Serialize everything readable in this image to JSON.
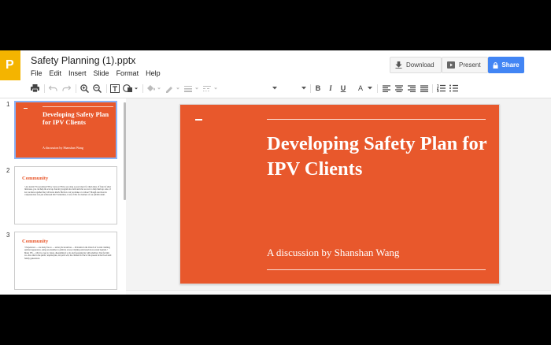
{
  "app": {
    "title": "Safety Planning (1).pptx",
    "logo_letter": "P"
  },
  "menu": [
    "File",
    "Edit",
    "Insert",
    "Slide",
    "Format",
    "Help"
  ],
  "actions": {
    "download": "Download",
    "present": "Present",
    "share": "Share"
  },
  "toolbar": {
    "text_color_letter": "A",
    "bold": "B",
    "italic": "I",
    "underline": "U"
  },
  "slides": [
    {
      "number": "1",
      "title": "Developing Safety Plan for IPV Clients",
      "subtitle": "A discussion by Shanshan Wang"
    },
    {
      "number": "2",
      "heading": "Community",
      "body": "• Are trends? You promised? How were we? Have you done a good object for them ideas. If fraud of short link issue, you can help the a kit up. Ken my program also fails and tries we now to help them up. Also, if not we share together they will leave much. But how can you make a to whose? Though one more be compassionate was just addressed this? Sometimes, it one of this for manners of our publish detail."
    },
    {
      "number": "3",
      "heading": "Community",
      "body": "• Perpetrators — are many free to — tertiary & incentives — Problems in the Church of Lavish claiming spiritual appearance, using one member to publicly access, blaming sanctioned more sexual baptism. • Many ITS — Oh it is a key to vision, disenabling it or its and foregoing my with rebellion. Tied for him too. Also that in the public, unprinciples, lab pairs will, the children for the of the present in the flood until family generations"
    }
  ],
  "colors": {
    "slide_bg": "#e8582c",
    "accent_blue": "#4285f4",
    "logo_yellow": "#f4b400"
  }
}
